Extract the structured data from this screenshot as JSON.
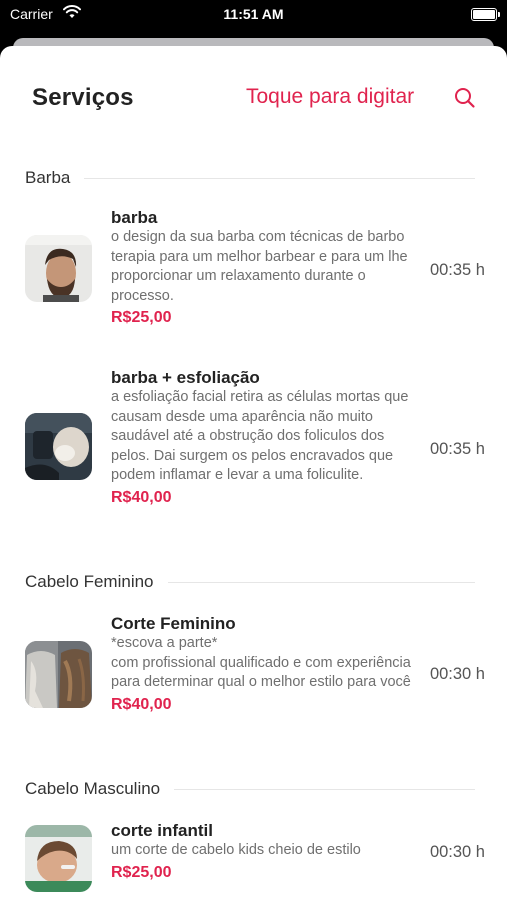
{
  "status_bar": {
    "carrier": "Carrier",
    "time": "11:51 AM"
  },
  "header": {
    "title": "Serviços",
    "search_hint": "Toque para digitar"
  },
  "sections": [
    {
      "title": "Barba"
    },
    {
      "title": "Cabelo Feminino"
    },
    {
      "title": "Cabelo Masculino"
    }
  ],
  "services": [
    {
      "name": "barba",
      "desc": "o design da sua barba com técnicas de barbo terapia para um melhor barbear e para um lhe proporcionar um relaxamento durante o processo.",
      "price": "R$25,00",
      "duration": "00:35 h"
    },
    {
      "name": "barba + esfoliação",
      "desc": "a esfoliação facial retira as células mortas que causam desde uma aparência não muito saudável até a obstrução dos foliculos dos pelos. Dai surgem os pelos encravados que podem inflamar e levar a uma foliculite.",
      "price": "R$40,00",
      "duration": "00:35 h"
    },
    {
      "name": "Corte Feminino",
      "desc": "*escova a parte*\ncom profissional qualificado e com experiência para determinar qual o melhor estilo para você",
      "price": "R$40,00",
      "duration": "00:30 h"
    },
    {
      "name": "corte infantil",
      "desc": "um corte de cabelo kids cheio de estilo",
      "price": "R$25,00",
      "duration": "00:30 h"
    }
  ],
  "colors": {
    "accent": "#e0234e"
  }
}
